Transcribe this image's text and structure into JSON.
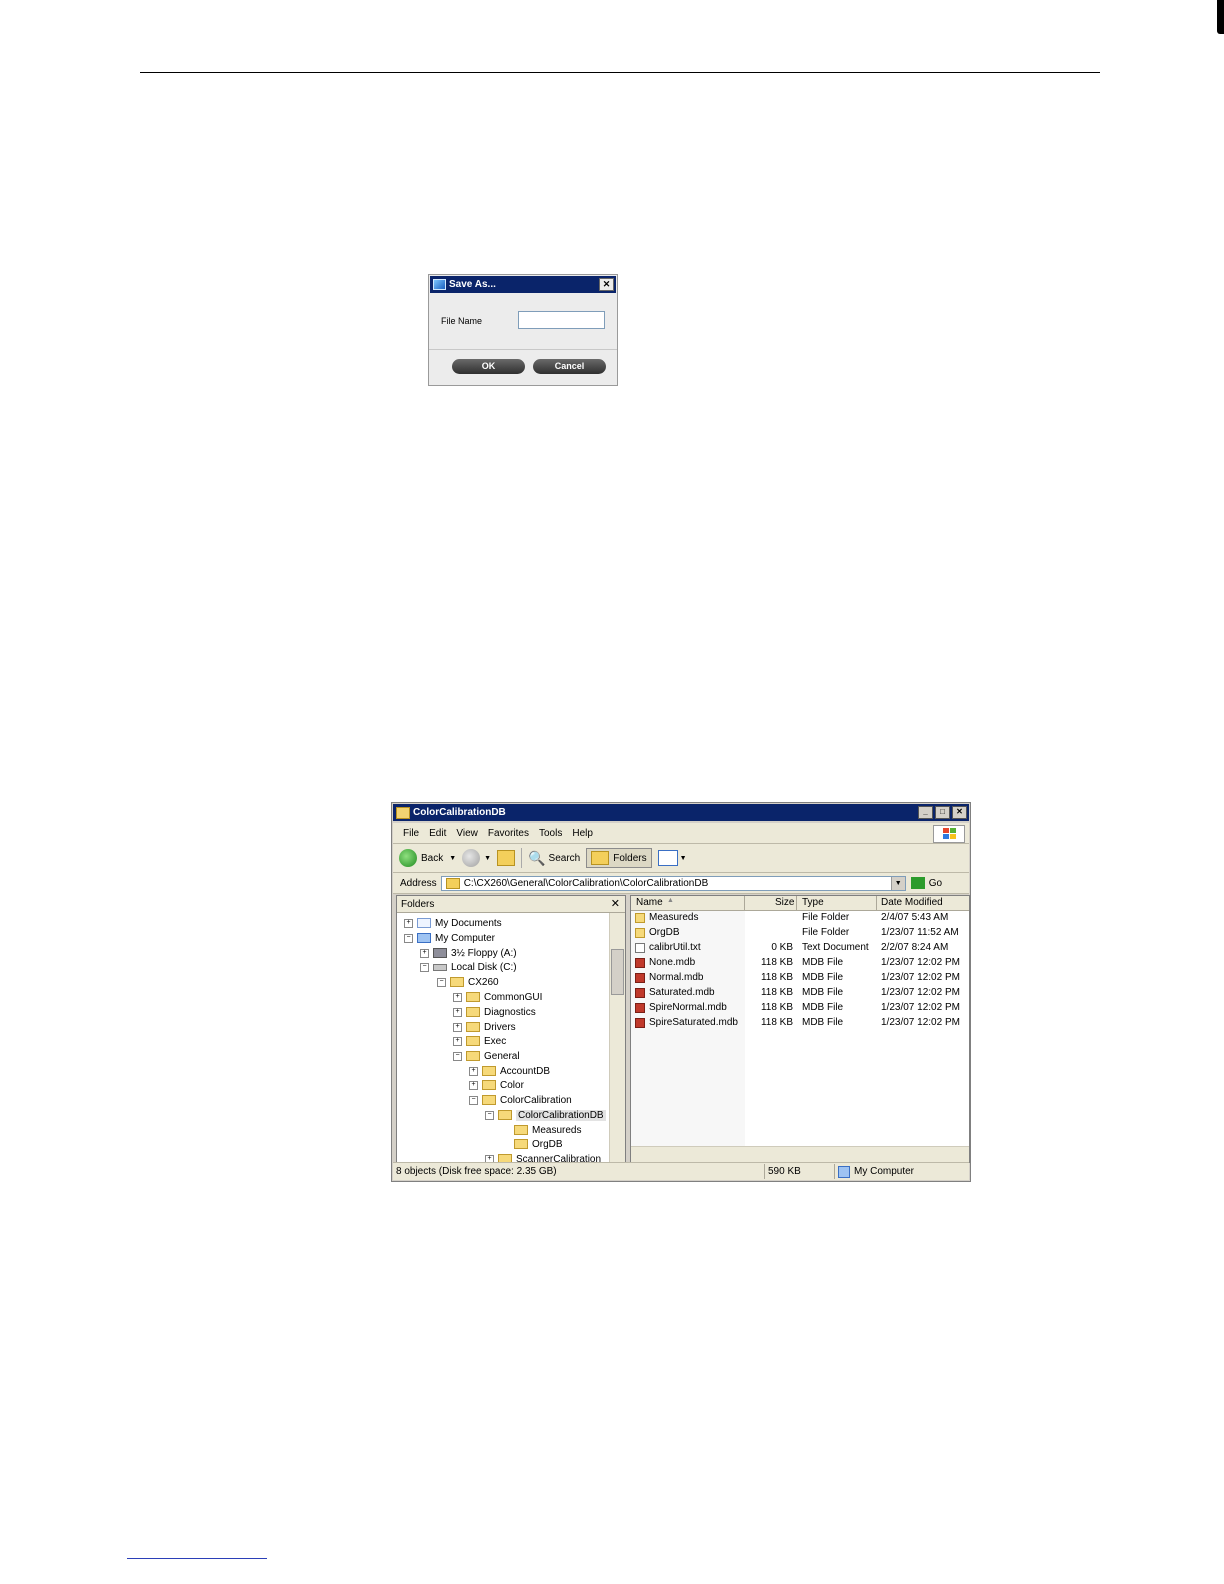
{
  "dialog": {
    "title": "Save As...",
    "close_glyph": "✕",
    "file_name_label": "File Name",
    "file_name_value": "",
    "ok_label": "OK",
    "cancel_label": "Cancel"
  },
  "explorer": {
    "title": "ColorCalibrationDB",
    "window_controls": {
      "minimize": "_",
      "maximize": "□",
      "close": "✕"
    },
    "menu": [
      "File",
      "Edit",
      "View",
      "Favorites",
      "Tools",
      "Help"
    ],
    "toolbar": {
      "back": "Back",
      "search": "Search",
      "folders": "Folders"
    },
    "address": {
      "label": "Address",
      "value": "C:\\CX260\\General\\ColorCalibration\\ColorCalibrationDB",
      "go": "Go"
    },
    "folders_pane": {
      "title": "Folders",
      "close_glyph": "✕",
      "nodes": [
        {
          "label": "My Documents",
          "expander": "+"
        },
        {
          "label": "My Computer",
          "expander": "−"
        },
        {
          "label": "3½ Floppy (A:)",
          "expander": "+"
        },
        {
          "label": "Local Disk (C:)",
          "expander": "−"
        },
        {
          "label": "CX260",
          "expander": "−"
        },
        {
          "label": "CommonGUI",
          "expander": "+"
        },
        {
          "label": "Diagnostics",
          "expander": "+"
        },
        {
          "label": "Drivers",
          "expander": "+"
        },
        {
          "label": "Exec",
          "expander": "+"
        },
        {
          "label": "General",
          "expander": "−"
        },
        {
          "label": "AccountDB",
          "expander": "+"
        },
        {
          "label": "Color",
          "expander": "+"
        },
        {
          "label": "ColorCalibration",
          "expander": "−"
        },
        {
          "label": "ColorCalibrationDB",
          "expander": "−"
        },
        {
          "label": "Measureds",
          "expander": ""
        },
        {
          "label": "OrgDB",
          "expander": ""
        },
        {
          "label": "ScannerCalibration",
          "expander": "+"
        }
      ]
    },
    "columns": {
      "name": "Name",
      "size": "Size",
      "type": "Type",
      "date": "Date Modified"
    },
    "files": [
      {
        "name": "Measureds",
        "size": "",
        "type": "File Folder",
        "date": "2/4/07 5:43 AM"
      },
      {
        "name": "OrgDB",
        "size": "",
        "type": "File Folder",
        "date": "1/23/07 11:52 AM"
      },
      {
        "name": "calibrUtil.txt",
        "size": "0 KB",
        "type": "Text Document",
        "date": "2/2/07 8:24 AM"
      },
      {
        "name": "None.mdb",
        "size": "118 KB",
        "type": "MDB File",
        "date": "1/23/07 12:02 PM"
      },
      {
        "name": "Normal.mdb",
        "size": "118 KB",
        "type": "MDB File",
        "date": "1/23/07 12:02 PM"
      },
      {
        "name": "Saturated.mdb",
        "size": "118 KB",
        "type": "MDB File",
        "date": "1/23/07 12:02 PM"
      },
      {
        "name": "SpireNormal.mdb",
        "size": "118 KB",
        "type": "MDB File",
        "date": "1/23/07 12:02 PM"
      },
      {
        "name": "SpireSaturated.mdb",
        "size": "118 KB",
        "type": "MDB File",
        "date": "1/23/07 12:02 PM"
      }
    ],
    "status": {
      "objects": "8 objects (Disk free space: 2.35 GB)",
      "size": "590 KB",
      "location": "My Computer"
    }
  }
}
